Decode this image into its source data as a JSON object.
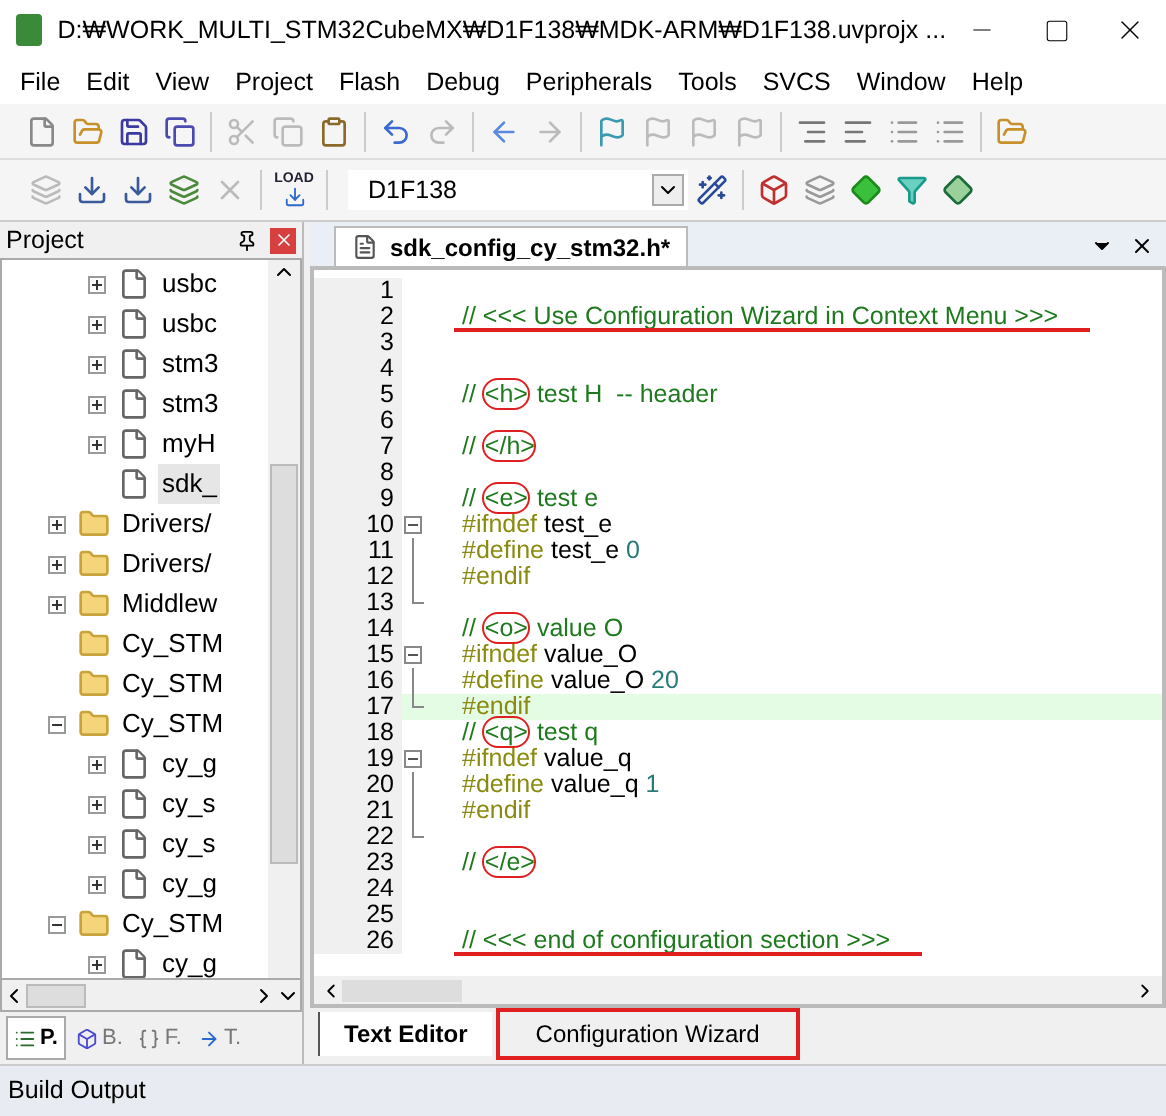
{
  "window": {
    "title": "D:₩WORK_MULTI_STM32CubeMX₩D1F138₩MDK-ARM₩D1F138.uvprojx ..."
  },
  "menu": [
    "File",
    "Edit",
    "View",
    "Project",
    "Flash",
    "Debug",
    "Peripherals",
    "Tools",
    "SVCS",
    "Window",
    "Help"
  ],
  "toolbar": {
    "load_label": "LOAD",
    "target": "D1F138"
  },
  "project_panel": {
    "title": "Project",
    "tree": [
      {
        "kind": "continued",
        "children": [
          {
            "kind": "file",
            "label": "usbc",
            "expanded": false
          },
          {
            "kind": "file",
            "label": "usbc",
            "expanded": false
          },
          {
            "kind": "file",
            "label": "stm3",
            "expanded": false
          },
          {
            "kind": "file",
            "label": "stm3",
            "expanded": false
          },
          {
            "kind": "file",
            "label": "myH",
            "expanded": false
          },
          {
            "kind": "file",
            "label": "sdk_",
            "selected": true
          }
        ]
      },
      {
        "kind": "folder",
        "label": "Drivers/",
        "expanded": false
      },
      {
        "kind": "folder",
        "label": "Drivers/",
        "expanded": false
      },
      {
        "kind": "folder",
        "label": "Middlew",
        "expanded": false
      },
      {
        "kind": "folder",
        "label": "Cy_STM"
      },
      {
        "kind": "folder",
        "label": "Cy_STM"
      },
      {
        "kind": "folder",
        "label": "Cy_STM",
        "expanded": true,
        "children": [
          {
            "kind": "file",
            "label": "cy_g",
            "expanded": false
          },
          {
            "kind": "file",
            "label": "cy_s",
            "expanded": false
          },
          {
            "kind": "file",
            "label": "cy_s",
            "expanded": false
          },
          {
            "kind": "file",
            "label": "cy_g",
            "expanded": false
          }
        ]
      },
      {
        "kind": "folder",
        "label": "Cy_STM",
        "expanded": true,
        "children": [
          {
            "kind": "file",
            "label": "cy_g",
            "expanded": false
          }
        ]
      }
    ],
    "tabs": [
      {
        "label": "P.",
        "selected": true
      },
      {
        "label": "B.",
        "selected": false
      },
      {
        "label": "F.",
        "selected": false
      },
      {
        "label": "T.",
        "selected": false
      }
    ]
  },
  "editor": {
    "tab": "sdk_config_cy_stm32.h*",
    "lines": [
      {
        "number": "1",
        "kind": "plain"
      },
      {
        "number": "2",
        "kind": "plain",
        "underlined": true,
        "tokens": [
          {
            "kind": "comment",
            "text": "// <<< Use Configuration Wizard in Context Menu >>>"
          }
        ]
      },
      {
        "number": "3",
        "kind": "plain"
      },
      {
        "number": "4",
        "kind": "plain"
      },
      {
        "number": "5",
        "kind": "plain",
        "tokens": [
          {
            "kind": "comment",
            "text": "// "
          },
          {
            "kind": "comment",
            "text": "<h>",
            "circled": true
          },
          {
            "kind": "comment",
            "text": " test H  -- header"
          }
        ]
      },
      {
        "number": "6",
        "kind": "plain"
      },
      {
        "number": "7",
        "kind": "plain",
        "tokens": [
          {
            "kind": "comment",
            "text": "// "
          },
          {
            "kind": "comment",
            "text": "</h>",
            "circled": true
          }
        ]
      },
      {
        "number": "8",
        "kind": "plain"
      },
      {
        "number": "9",
        "kind": "plain",
        "tokens": [
          {
            "kind": "comment",
            "text": "// "
          },
          {
            "kind": "comment",
            "text": "<e>",
            "circled": true
          },
          {
            "kind": "comment",
            "text": " test e"
          }
        ]
      },
      {
        "number": "10",
        "kind": "fold_open",
        "tokens": [
          {
            "kind": "directive",
            "text": "#ifndef"
          },
          {
            "kind": "ident",
            "text": " test_e"
          }
        ]
      },
      {
        "number": "11",
        "kind": "fold_mid",
        "tokens": [
          {
            "kind": "directive",
            "text": "#define"
          },
          {
            "kind": "ident",
            "text": " test_e "
          },
          {
            "kind": "number",
            "text": "0"
          }
        ]
      },
      {
        "number": "12",
        "kind": "fold_mid",
        "tokens": [
          {
            "kind": "directive",
            "text": "#endif"
          }
        ]
      },
      {
        "number": "13",
        "kind": "fold_end"
      },
      {
        "number": "14",
        "kind": "plain",
        "tokens": [
          {
            "kind": "comment",
            "text": "// "
          },
          {
            "kind": "comment",
            "text": "<o>",
            "circled": true
          },
          {
            "kind": "comment",
            "text": " value O"
          }
        ]
      },
      {
        "number": "15",
        "kind": "fold_open",
        "tokens": [
          {
            "kind": "directive",
            "text": "#ifndef"
          },
          {
            "kind": "ident",
            "text": " value_O"
          }
        ]
      },
      {
        "number": "16",
        "kind": "fold_mid",
        "tokens": [
          {
            "kind": "directive",
            "text": "#define"
          },
          {
            "kind": "ident",
            "text": " value_O "
          },
          {
            "kind": "number",
            "text": "20"
          }
        ]
      },
      {
        "number": "17",
        "kind": "fold_end",
        "highlighted": true,
        "tokens": [
          {
            "kind": "directive",
            "text": "#endif"
          }
        ]
      },
      {
        "number": "18",
        "kind": "plain",
        "tokens": [
          {
            "kind": "comment",
            "text": "// "
          },
          {
            "kind": "comment",
            "text": "<q>",
            "circled": true
          },
          {
            "kind": "comment",
            "text": " test q"
          }
        ]
      },
      {
        "number": "19",
        "kind": "fold_open",
        "tokens": [
          {
            "kind": "directive",
            "text": "#ifndef"
          },
          {
            "kind": "ident",
            "text": " value_q"
          }
        ]
      },
      {
        "number": "20",
        "kind": "fold_mid",
        "tokens": [
          {
            "kind": "directive",
            "text": "#define"
          },
          {
            "kind": "ident",
            "text": " value_q "
          },
          {
            "kind": "number",
            "text": "1"
          }
        ]
      },
      {
        "number": "21",
        "kind": "fold_mid",
        "tokens": [
          {
            "kind": "directive",
            "text": "#endif"
          }
        ]
      },
      {
        "number": "22",
        "kind": "fold_end"
      },
      {
        "number": "23",
        "kind": "plain",
        "tokens": [
          {
            "kind": "comment",
            "text": "// "
          },
          {
            "kind": "comment",
            "text": "</e>",
            "circled": true
          }
        ]
      },
      {
        "number": "24",
        "kind": "plain"
      },
      {
        "number": "25",
        "kind": "plain"
      },
      {
        "number": "26",
        "kind": "plain",
        "underlined": true,
        "tokens": [
          {
            "kind": "comment",
            "text": "// <<< end of configuration section >>>"
          }
        ]
      }
    ],
    "bottom_tabs": [
      {
        "label": "Text Editor",
        "selected": true,
        "boxed": false
      },
      {
        "label": "Configuration Wizard",
        "selected": false,
        "boxed": true
      }
    ]
  },
  "build_output": {
    "title": "Build Output"
  }
}
